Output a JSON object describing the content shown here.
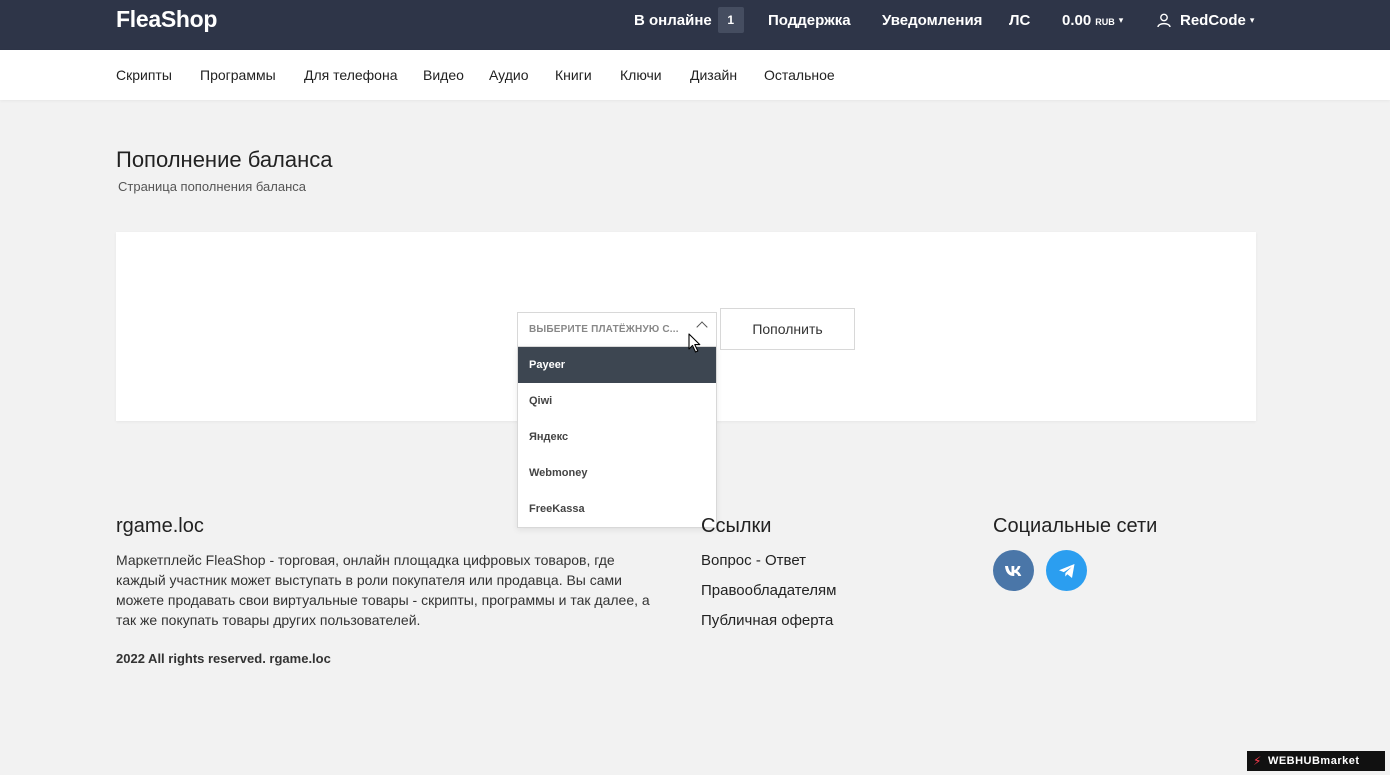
{
  "header": {
    "logo": "FleaShop",
    "online_label": "В онлайне",
    "online_count": "1",
    "support": "Поддержка",
    "notifications": "Уведомления",
    "messages": "ЛС",
    "balance_amount": "0.00",
    "balance_currency": "RUB",
    "username": "RedCode"
  },
  "categories": [
    "Скрипты",
    "Программы",
    "Для телефона",
    "Видео",
    "Аудио",
    "Книги",
    "Ключи",
    "Дизайн",
    "Остальное"
  ],
  "page": {
    "title": "Пополнение баланса",
    "subtitle": "Страница пополнения баланса"
  },
  "payment": {
    "select_placeholder": "ВЫБЕРИТЕ ПЛАТЁЖНУЮ С...",
    "options": [
      "Payeer",
      "Qiwi",
      "Яндекс",
      "Webmoney",
      "FreeKassa"
    ],
    "highlighted_option": "Payeer",
    "submit_label": "Пополнить"
  },
  "footer": {
    "site_title": "rgame.loc",
    "description": "Маркетплейс FleaShop - торговая, онлайн площадка цифровых товаров, где каждый участник может выступать в роли покупателя или продавца. Вы сами можете продавать свои виртуальные товары - скрипты, программы и так далее, а так же покупать товары других пользователей.",
    "copyright": "2022 All rights reserved. rgame.loc",
    "links_title": "Ссылки",
    "links": [
      "Вопрос - Ответ",
      "Правообладателям",
      "Публичная оферта"
    ],
    "social_title": "Социальные сети",
    "social_icons": [
      "vk-icon",
      "telegram-icon"
    ]
  },
  "watermark": "WEBHUBmarket",
  "colors": {
    "header_bg": "#2e3548",
    "dropdown_active_bg": "#3d4651",
    "vk": "#4a76a8",
    "telegram": "#2b9ef0"
  }
}
